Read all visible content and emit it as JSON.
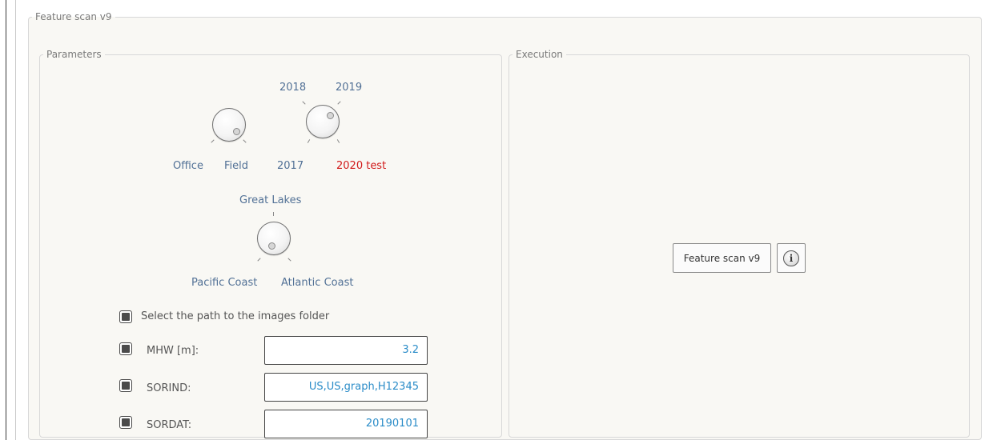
{
  "main_group": {
    "title": "Feature scan v9"
  },
  "parameters": {
    "title": "Parameters",
    "mode_knob": {
      "left_label": "Office",
      "right_label": "Field"
    },
    "year_knob": {
      "top_left_label": "2018",
      "top_right_label": "2019",
      "bottom_left_label": "2017",
      "bottom_right_label": "2020 test",
      "highlight_color": "#d11a1a"
    },
    "region_knob": {
      "top_label": "Great Lakes",
      "left_label": "Pacific Coast",
      "right_label": "Atlantic Coast"
    },
    "images_folder": {
      "label": "Select the path to the images folder"
    },
    "mhw": {
      "label": "MHW [m]:",
      "value": "3.2"
    },
    "sorind": {
      "label": "SORIND:",
      "value": "US,US,graph,H12345"
    },
    "sordat": {
      "label": "SORDAT:",
      "value": "20190101"
    }
  },
  "execution": {
    "title": "Execution",
    "run_button_label": "Feature scan v9",
    "info_icon_glyph": "i"
  }
}
